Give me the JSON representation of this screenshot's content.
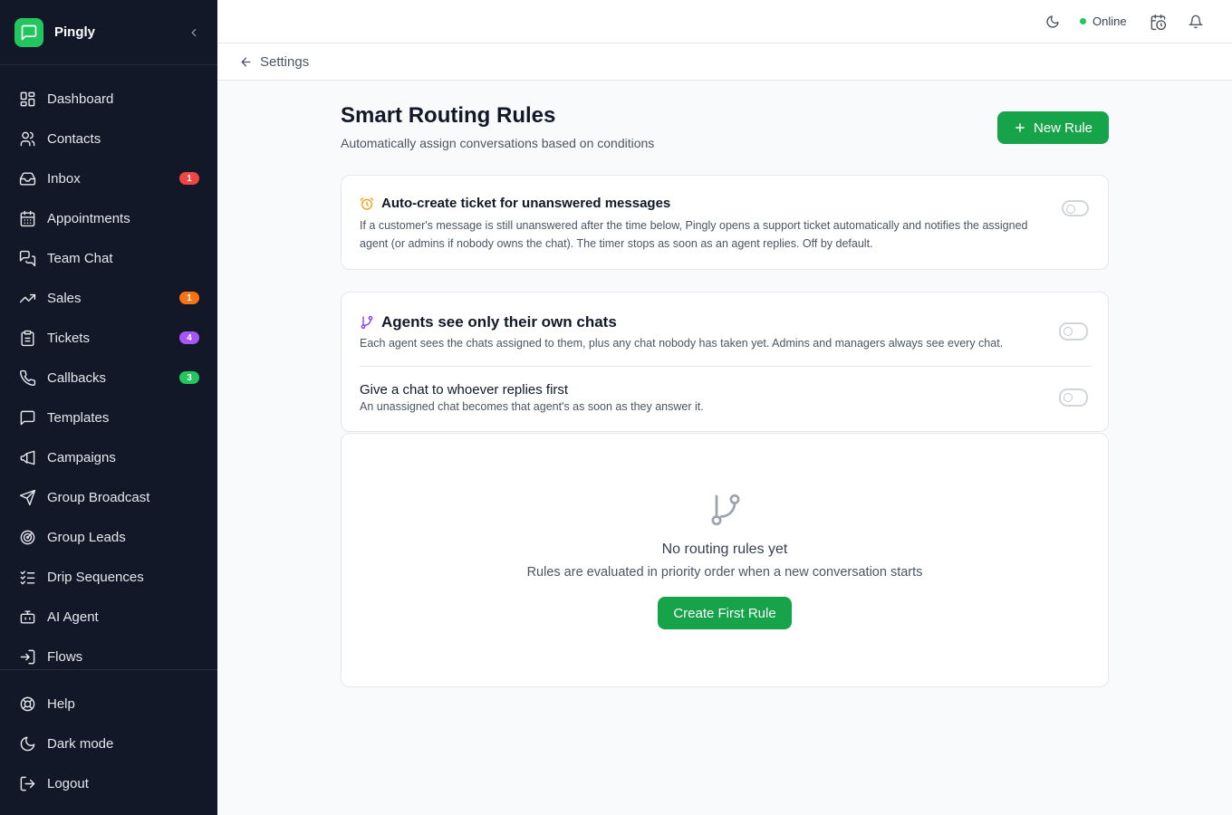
{
  "app": {
    "name": "Pingly"
  },
  "sidebar": {
    "items": [
      {
        "label": "Dashboard",
        "icon": "dashboard-icon"
      },
      {
        "label": "Contacts",
        "icon": "contacts-icon"
      },
      {
        "label": "Inbox",
        "icon": "inbox-icon",
        "badge": "1",
        "badge_color": "#ef4444"
      },
      {
        "label": "Appointments",
        "icon": "calendar-icon"
      },
      {
        "label": "Team Chat",
        "icon": "team-chat-icon"
      },
      {
        "label": "Sales",
        "icon": "trending-up-icon",
        "badge": "1",
        "badge_color": "#f97316"
      },
      {
        "label": "Tickets",
        "icon": "clipboard-icon",
        "badge": "4",
        "badge_color": "#a855f7"
      },
      {
        "label": "Callbacks",
        "icon": "phone-icon",
        "badge": "3",
        "badge_color": "#22c55e"
      },
      {
        "label": "Templates",
        "icon": "message-square-icon"
      },
      {
        "label": "Campaigns",
        "icon": "megaphone-icon"
      },
      {
        "label": "Group Broadcast",
        "icon": "send-icon"
      },
      {
        "label": "Group Leads",
        "icon": "radar-icon"
      },
      {
        "label": "Drip Sequences",
        "icon": "list-checks-icon"
      },
      {
        "label": "AI Agent",
        "icon": "bot-icon"
      },
      {
        "label": "Flows",
        "icon": "flow-icon"
      }
    ],
    "footer": [
      {
        "label": "Help",
        "icon": "life-buoy-icon"
      },
      {
        "label": "Dark mode",
        "icon": "moon-icon"
      },
      {
        "label": "Logout",
        "icon": "logout-icon"
      }
    ]
  },
  "topbar": {
    "status": "Online",
    "status_color": "#22c55e"
  },
  "breadcrumb": {
    "label": "Settings"
  },
  "page": {
    "title": "Smart Routing Rules",
    "subtitle": "Automatically assign conversations based on conditions",
    "new_rule_label": "New Rule"
  },
  "auto_ticket": {
    "title": "Auto-create ticket for unanswered messages",
    "description": "If a customer's message is still unanswered after the time below, Pingly opens a support ticket automatically and notifies the assigned agent (or admins if nobody owns the chat). The timer stops as soon as an agent replies. Off by default.",
    "enabled": false
  },
  "visibility": {
    "own_chats_title": "Agents see only their own chats",
    "own_chats_desc": "Each agent sees the chats assigned to them, plus any chat nobody has taken yet. Admins and managers always see every chat.",
    "own_chats_enabled": false,
    "first_reply_title": "Give a chat to whoever replies first",
    "first_reply_desc": "An unassigned chat becomes that agent's as soon as they answer it.",
    "first_reply_enabled": false
  },
  "empty_state": {
    "title": "No routing rules yet",
    "description": "Rules are evaluated in priority order when a new conversation starts",
    "button_label": "Create First Rule"
  },
  "colors": {
    "accent": "#16a34a",
    "sidebar_bg": "#121828"
  }
}
